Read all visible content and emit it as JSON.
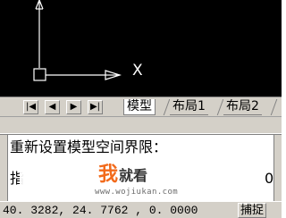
{
  "canvas": {
    "ucs_x_label": "X"
  },
  "layout_tabs": {
    "nav_buttons": [
      "|◀",
      "◀",
      "▶",
      "▶|"
    ],
    "tabs": [
      {
        "label": "模型",
        "active": true
      },
      {
        "label": "布局1",
        "active": false
      },
      {
        "label": "布局2",
        "active": false
      }
    ]
  },
  "command_window": {
    "line1": "重新设置模型空间界限：",
    "line2": "指",
    "line2_right": "0"
  },
  "watermark": {
    "logo_char": "我",
    "title": "就看",
    "url": "www.wojiukan.com"
  },
  "status_bar": {
    "coordinates": "40. 3282,  24. 7762  , 0. 0000",
    "snap_button": "捕捉"
  },
  "colors": {
    "canvas_bg": "#000000",
    "ucs_icon": "#ffffff",
    "chrome_bg": "#d4d0c8",
    "watermark_accent": "#f26a1b"
  }
}
